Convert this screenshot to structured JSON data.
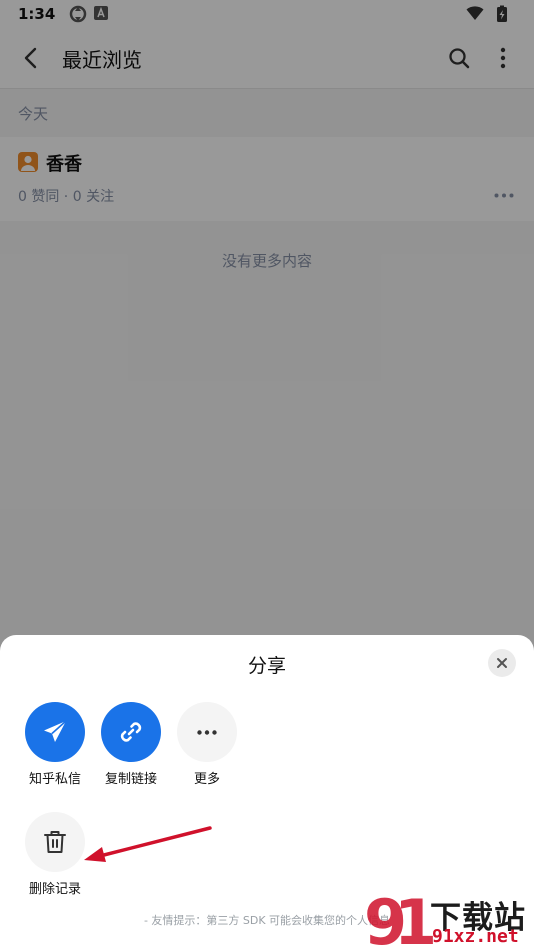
{
  "status_bar": {
    "time": "1:34"
  },
  "top_bar": {
    "title": "最近浏览"
  },
  "section": {
    "label": "今天"
  },
  "list": {
    "items": [
      {
        "name": "香香",
        "meta": "0 赞同 · 0 关注"
      }
    ],
    "end_text": "没有更多内容"
  },
  "share_sheet": {
    "title": "分享",
    "options": [
      {
        "label": "知乎私信",
        "icon": "paper-plane-icon"
      },
      {
        "label": "复制链接",
        "icon": "link-icon"
      },
      {
        "label": "更多",
        "icon": "more-horizontal-icon"
      }
    ],
    "actions": [
      {
        "label": "删除记录",
        "icon": "trash-icon"
      }
    ],
    "tip": "- 友情提示：第三方 SDK 可能会收集您的个人信息"
  },
  "watermark": {
    "brand": "下载站",
    "url": "91xz.net"
  },
  "colors": {
    "accent": "#1a73e8",
    "arrow": "#d0112b",
    "avatar": "#f18c2c"
  }
}
